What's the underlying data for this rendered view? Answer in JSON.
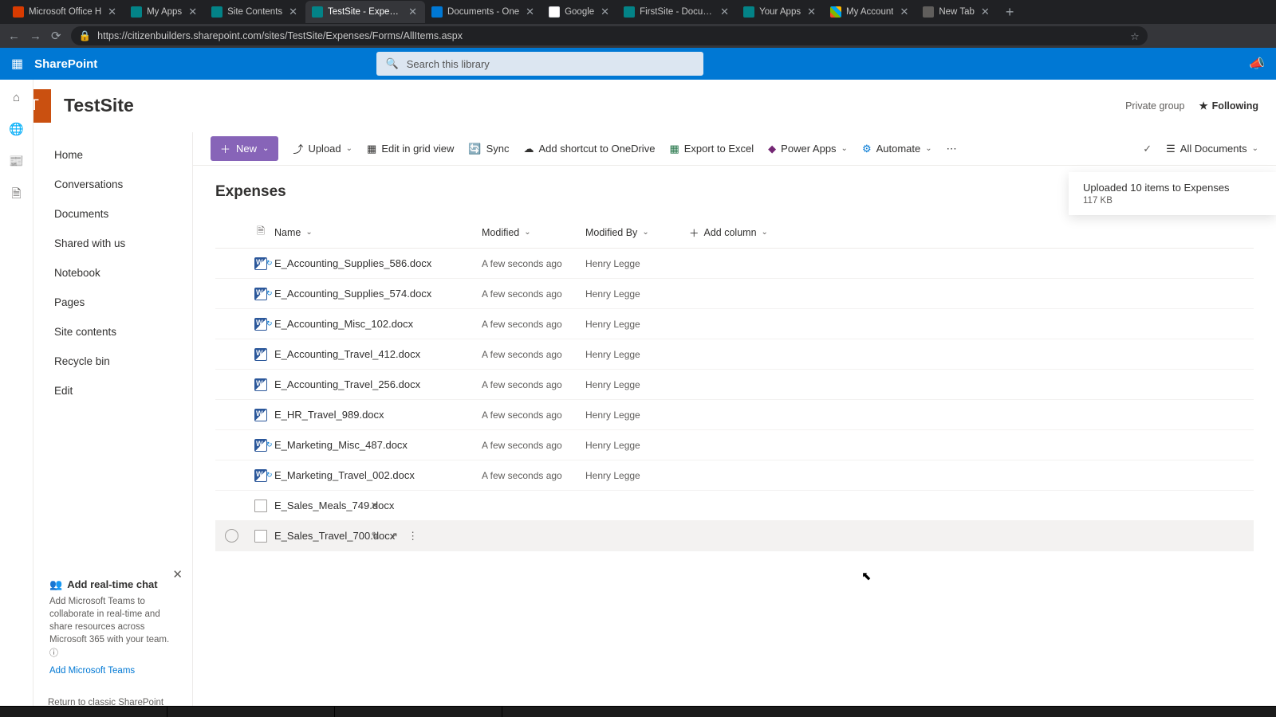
{
  "browser": {
    "tabs": [
      {
        "title": "Microsoft Office H",
        "fav": "fv-red"
      },
      {
        "title": "My Apps",
        "fav": "fv-teal"
      },
      {
        "title": "Site Contents",
        "fav": "fv-teal"
      },
      {
        "title": "TestSite - Expenses",
        "fav": "fv-teal",
        "active": true
      },
      {
        "title": "Documents - One",
        "fav": "fv-blue"
      },
      {
        "title": "Google",
        "fav": "fv-g"
      },
      {
        "title": "FirstSite - Docume",
        "fav": "fv-teal"
      },
      {
        "title": "Your Apps",
        "fav": "fv-teal"
      },
      {
        "title": "My Account",
        "fav": "fv-ms"
      },
      {
        "title": "New Tab",
        "fav": "fv-grey"
      }
    ],
    "url": "https://citizenbuilders.sharepoint.com/sites/TestSite/Expenses/Forms/AllItems.aspx"
  },
  "suite": {
    "brand": "SharePoint",
    "search_placeholder": "Search this library"
  },
  "site": {
    "logo_letter": "T",
    "title": "TestSite",
    "privacy": "Private group",
    "follow": "Following"
  },
  "leftnav": {
    "items": [
      "Home",
      "Conversations",
      "Documents",
      "Shared with us",
      "Notebook",
      "Pages",
      "Site contents",
      "Recycle bin",
      "Edit"
    ],
    "promo_title": "Add real-time chat",
    "promo_body": "Add Microsoft Teams to collaborate in real-time and share resources across Microsoft 365 with your team.",
    "promo_link": "Add Microsoft Teams",
    "classic": "Return to classic SharePoint"
  },
  "commands": {
    "new": "New",
    "upload": "Upload",
    "edit_grid": "Edit in grid view",
    "sync": "Sync",
    "shortcut": "Add shortcut to OneDrive",
    "export": "Export to Excel",
    "powerapps": "Power Apps",
    "automate": "Automate",
    "view": "All Documents"
  },
  "list": {
    "title": "Expenses",
    "columns": {
      "name": "Name",
      "modified": "Modified",
      "modified_by": "Modified By",
      "add": "Add column"
    },
    "rows": [
      {
        "name": "E_Accounting_Supplies_586.docx",
        "modified": "A few seconds ago",
        "by": "Henry Legge",
        "icon": "docx",
        "sync": true
      },
      {
        "name": "E_Accounting_Supplies_574.docx",
        "modified": "A few seconds ago",
        "by": "Henry Legge",
        "icon": "docx",
        "sync": true
      },
      {
        "name": "E_Accounting_Misc_102.docx",
        "modified": "A few seconds ago",
        "by": "Henry Legge",
        "icon": "docx",
        "sync": true
      },
      {
        "name": "E_Accounting_Travel_412.docx",
        "modified": "A few seconds ago",
        "by": "Henry Legge",
        "icon": "docx"
      },
      {
        "name": "E_Accounting_Travel_256.docx",
        "modified": "A few seconds ago",
        "by": "Henry Legge",
        "icon": "docx"
      },
      {
        "name": "E_HR_Travel_989.docx",
        "modified": "A few seconds ago",
        "by": "Henry Legge",
        "icon": "docx"
      },
      {
        "name": "E_Marketing_Misc_487.docx",
        "modified": "A few seconds ago",
        "by": "Henry Legge",
        "icon": "docx",
        "sync": true
      },
      {
        "name": "E_Marketing_Travel_002.docx",
        "modified": "A few seconds ago",
        "by": "Henry Legge",
        "icon": "docx",
        "sync": true
      },
      {
        "name": "E_Sales_Meals_749.docx",
        "modified": "",
        "by": "",
        "icon": "generic",
        "pending": true
      },
      {
        "name": "E_Sales_Travel_700.docx",
        "modified": "",
        "by": "",
        "icon": "generic",
        "hovered": true,
        "actions": true
      }
    ]
  },
  "toast": {
    "title": "Uploaded 10 items to Expenses",
    "sub": "117 KB"
  }
}
